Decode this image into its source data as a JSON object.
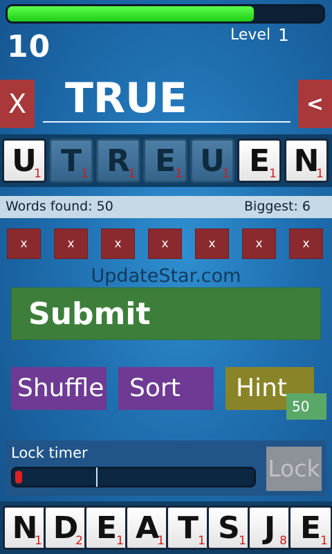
{
  "progress": {
    "fraction": 0.78,
    "color": "#2fe02a"
  },
  "score": "10",
  "level": {
    "label": "Level",
    "value": "1"
  },
  "clear_label": "X",
  "backspace_label": "<",
  "current_word": "TRUE",
  "top_tiles": [
    {
      "letter": "U",
      "points": "1",
      "used": false
    },
    {
      "letter": "T",
      "points": "1",
      "used": true
    },
    {
      "letter": "R",
      "points": "1",
      "used": true
    },
    {
      "letter": "E",
      "points": "1",
      "used": true
    },
    {
      "letter": "U",
      "points": "1",
      "used": true
    },
    {
      "letter": "E",
      "points": "1",
      "used": false
    },
    {
      "letter": "N",
      "points": "1",
      "used": false
    }
  ],
  "stats": {
    "words_found": "Words found: 50",
    "biggest": "Biggest: 6"
  },
  "slots": [
    "x",
    "x",
    "x",
    "x",
    "x",
    "x",
    "x"
  ],
  "watermark": "UpdateStar.com",
  "buttons": {
    "submit": "Submit",
    "shuffle": "Shuffle",
    "sort": "Sort",
    "hint": "Hint",
    "hint_count": "50",
    "lock": "Lock"
  },
  "lock_timer": {
    "label": "Lock timer",
    "fraction": 0.03
  },
  "bottom_tiles": [
    {
      "letter": "N",
      "points": "1"
    },
    {
      "letter": "D",
      "points": "2"
    },
    {
      "letter": "E",
      "points": "1"
    },
    {
      "letter": "A",
      "points": "1"
    },
    {
      "letter": "T",
      "points": "1"
    },
    {
      "letter": "S",
      "points": "1"
    },
    {
      "letter": "J",
      "points": "8"
    },
    {
      "letter": "E",
      "points": "1"
    }
  ]
}
